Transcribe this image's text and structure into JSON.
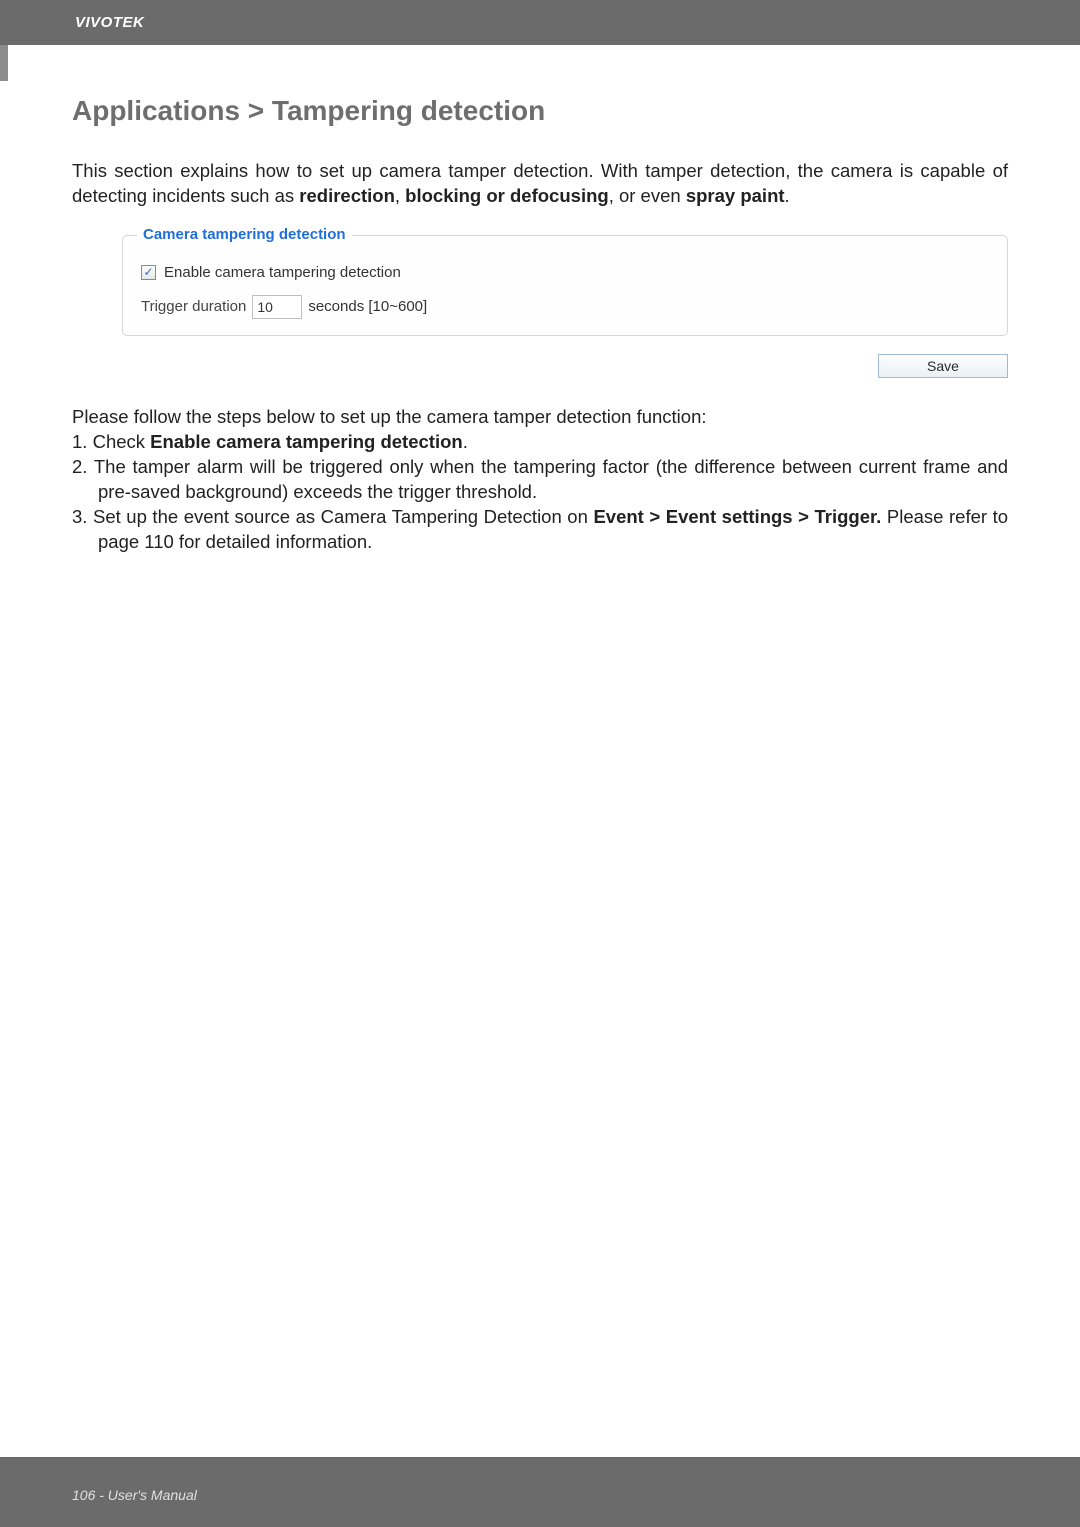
{
  "header": {
    "brand": "VIVOTEK"
  },
  "page": {
    "title": "Applications > Tampering detection",
    "intro_prefix": "This section explains how to set up camera tamper detection. With tamper detection, the camera is capable of detecting incidents such as ",
    "intro_bold1": "redirection",
    "intro_sep1": ", ",
    "intro_bold2": "blocking or defocusing",
    "intro_sep2": ", or even ",
    "intro_bold3": "spray paint",
    "intro_suffix": "."
  },
  "fieldset": {
    "legend": "Camera tampering detection",
    "enable_label": "Enable camera tampering detection",
    "enable_checked": "✓",
    "trigger_label": "Trigger duration",
    "trigger_value": "10",
    "trigger_unit": "seconds [10~600]"
  },
  "save_button": "Save",
  "steps": {
    "intro": "Please follow the steps below to set up the camera tamper detection function:",
    "s1_num": "1.",
    "s1_a": " Check ",
    "s1_b": "Enable camera tampering detection",
    "s1_c": ".",
    "s2_num": "2.",
    "s2": " The tamper alarm will be triggered only when the tampering factor (the difference between current frame and pre-saved background) exceeds the trigger threshold.",
    "s3_num": "3.",
    "s3_a": " Set up the event source as Camera Tampering Detection on ",
    "s3_b": "Event > Event settings > Trigger.",
    "s3_c": " Please refer to page 110 for detailed information."
  },
  "footer": {
    "text": "106 - User's Manual"
  }
}
